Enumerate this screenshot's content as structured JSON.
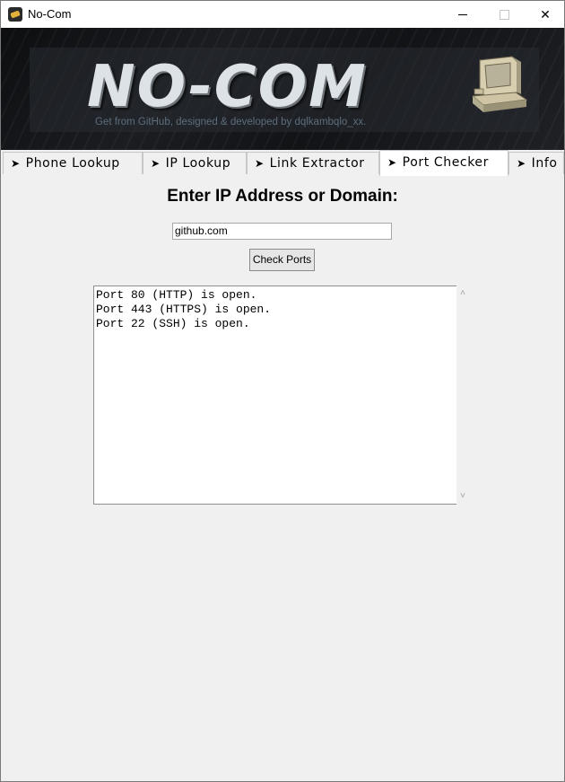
{
  "window": {
    "title": "No-Com"
  },
  "banner": {
    "logo": "NO-COM",
    "tagline": "Get from GitHub, designed & developed by dqlkambqlo_xx."
  },
  "tabs": [
    {
      "label": "Phone Lookup",
      "active": false
    },
    {
      "label": "IP Lookup",
      "active": false
    },
    {
      "label": "Link Extractor",
      "active": false
    },
    {
      "label": "Port Checker",
      "active": true
    },
    {
      "label": "Info",
      "active": false
    }
  ],
  "port_checker": {
    "heading": "Enter IP Address or Domain:",
    "input_value": "github.com",
    "button_label": "Check Ports",
    "output_lines": [
      "Port 80 (HTTP) is open.",
      "Port 443 (HTTPS) is open.",
      "Port 22 (SSH) is open."
    ]
  },
  "icons": {
    "app": "no-com-app-icon",
    "arrow": "➤",
    "scroll_up": "˄",
    "scroll_down": "˅"
  }
}
